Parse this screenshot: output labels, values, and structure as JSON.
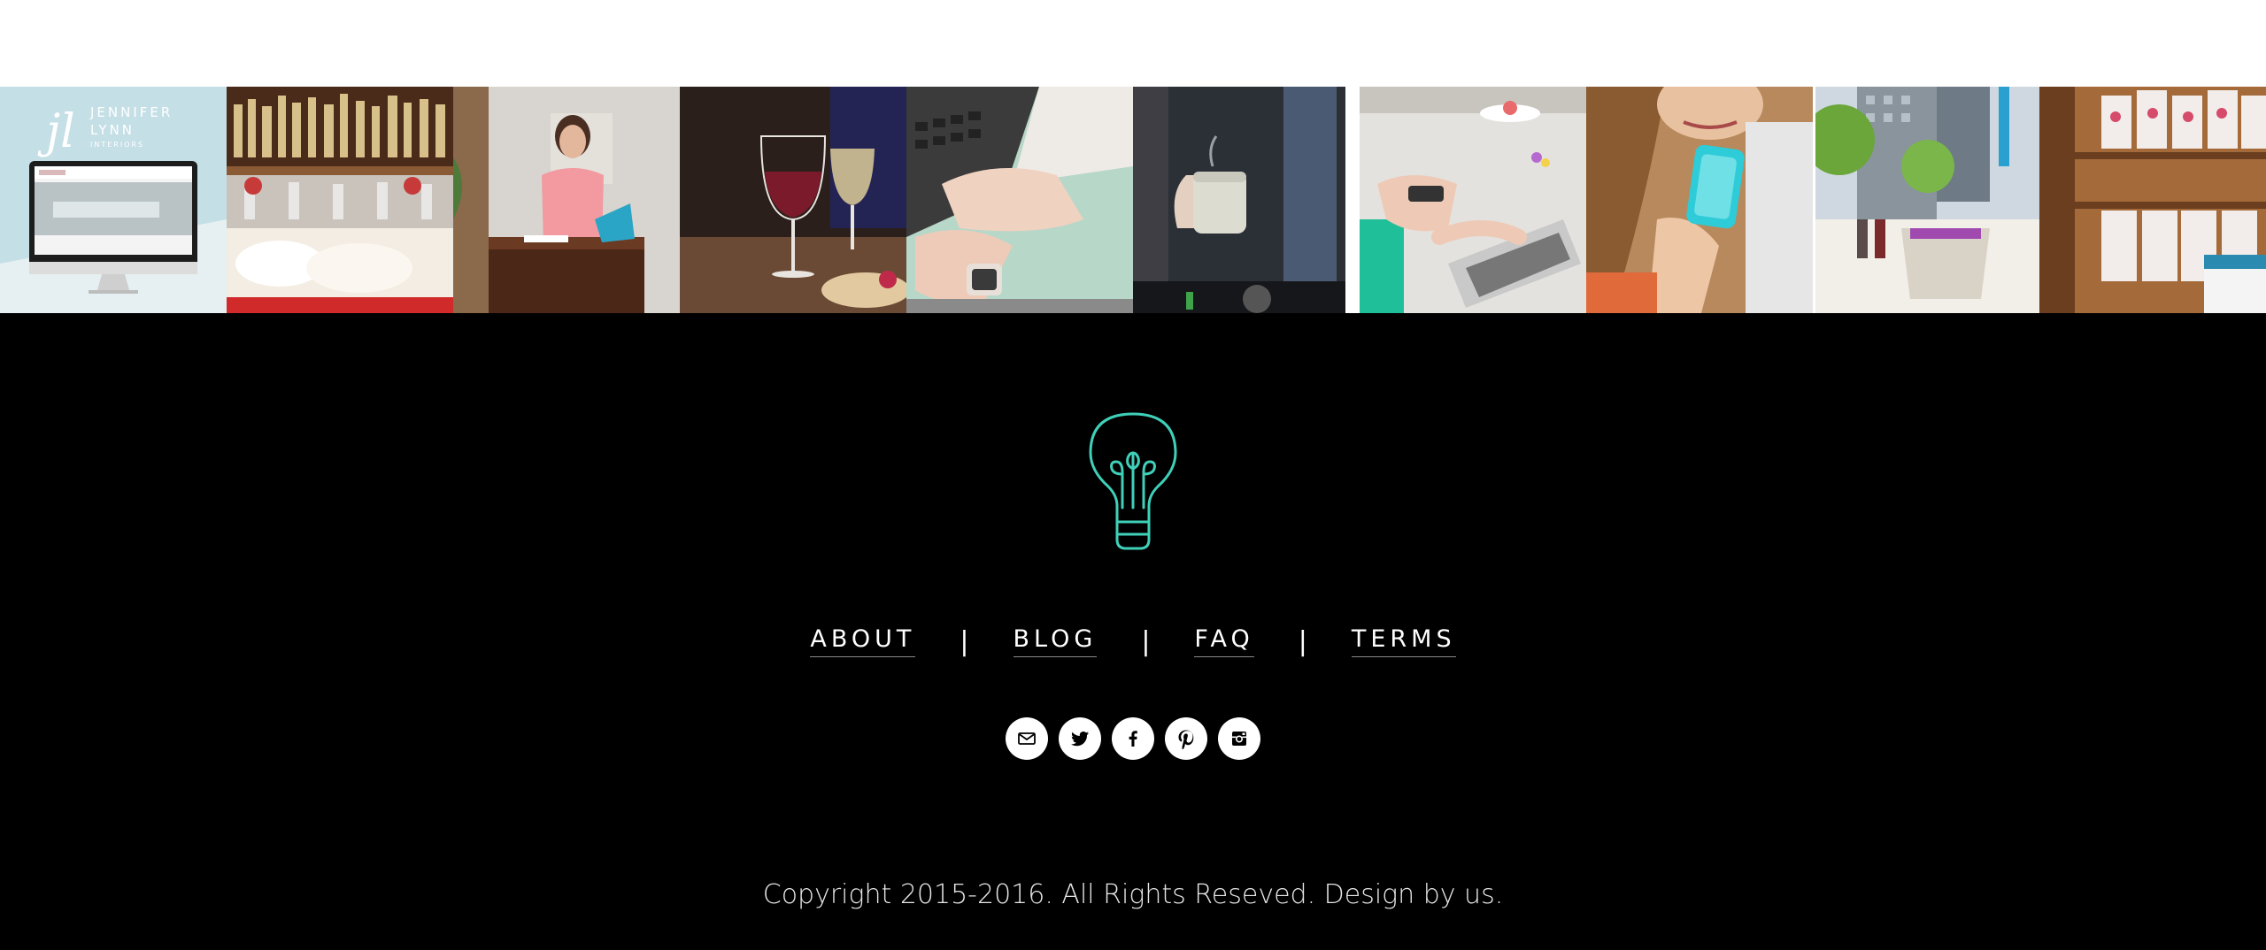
{
  "gallery": {
    "tiles": [
      {
        "name": "jennifer-lynn-interiors-website-mockup",
        "logo_lines": [
          "JENNIFER",
          "LYNN",
          "INTERIORS"
        ],
        "monogram": "jl"
      },
      {
        "name": "bar-shelves-bottles-photo"
      },
      {
        "name": "woman-at-table-laptop-photo"
      },
      {
        "name": "wine-glasses-photo"
      },
      {
        "name": "hands-typing-laptop-photo"
      },
      {
        "name": "coffee-mug-photo"
      },
      {
        "name": "laptop-table-flowers-photo"
      },
      {
        "name": "woman-holding-phone-photo"
      },
      {
        "name": "city-street-planter-photo"
      },
      {
        "name": "shop-shelves-bags-photo"
      }
    ]
  },
  "footer": {
    "logo_icon": "lightbulb-icon",
    "accent_color": "#3fd0b9",
    "nav": [
      {
        "key": "about",
        "label": "ABOUT"
      },
      {
        "key": "blog",
        "label": "BLOG"
      },
      {
        "key": "faq",
        "label": "FAQ"
      },
      {
        "key": "terms",
        "label": "TERMS"
      }
    ],
    "separator": "|",
    "social": [
      {
        "key": "email",
        "icon": "mail-icon"
      },
      {
        "key": "twitter",
        "icon": "twitter-icon"
      },
      {
        "key": "facebook",
        "icon": "facebook-icon"
      },
      {
        "key": "pinterest",
        "icon": "pinterest-icon"
      },
      {
        "key": "instagram",
        "icon": "instagram-icon"
      }
    ],
    "copyright": "Copyright 2015-2016. All Rights Reseved. Design by us."
  }
}
